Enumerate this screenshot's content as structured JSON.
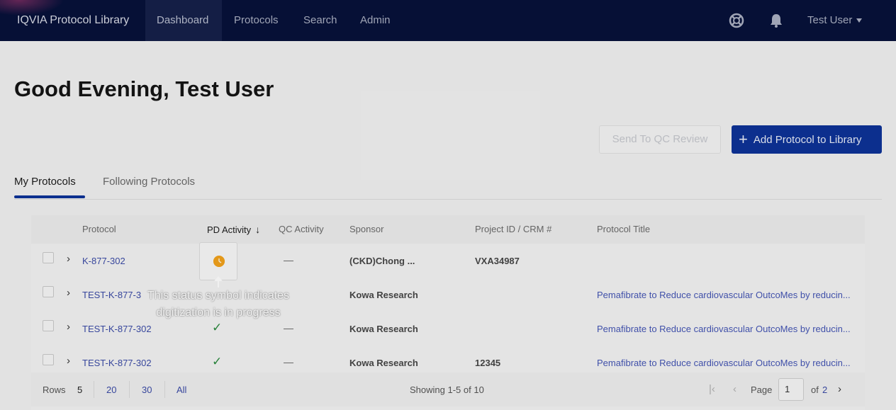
{
  "nav": {
    "brand": "IQVIA Protocol Library",
    "items": [
      {
        "label": "Dashboard"
      },
      {
        "label": "Protocols"
      },
      {
        "label": "Search"
      },
      {
        "label": "Admin"
      }
    ],
    "icons": [
      "help-icon",
      "bell-icon"
    ],
    "user": "Test User"
  },
  "greeting": "Good Evening, Test User",
  "actions": {
    "qc_review": "Send To QC Review",
    "add_protocol": "Add Protocol to Library"
  },
  "tabs": [
    {
      "label": "My Protocols"
    },
    {
      "label": "Following Protocols"
    }
  ],
  "table": {
    "headers": [
      "Protocol",
      "PD Activity",
      "QC Activity",
      "Sponsor",
      "Project ID / CRM #",
      "Protocol Title"
    ],
    "rows": [
      {
        "protocol": "K-877-302",
        "pd": "in-progress",
        "qc": "—",
        "sponsor": "(CKD)Chong ...",
        "project": "VXA34987",
        "title": ""
      },
      {
        "protocol": "TEST-K-877-3",
        "pd": "",
        "qc": "",
        "sponsor": "Kowa Research",
        "project": "",
        "title": "Pemafibrate to Reduce cardiovascular OutcoMes by reducin..."
      },
      {
        "protocol": "TEST-K-877-302",
        "pd": "✓",
        "qc": "—",
        "sponsor": "Kowa Research",
        "project": "",
        "title": "Pemafibrate to Reduce cardiovascular OutcoMes by reducin..."
      },
      {
        "protocol": "TEST-K-877-302",
        "pd": "✓",
        "qc": "—",
        "sponsor": "Kowa Research",
        "project": "12345",
        "title": "Pemafibrate to Reduce cardiovascular OutcoMes by reducin..."
      }
    ]
  },
  "tooltip": {
    "line1": "This status symbol indicates",
    "line2": "digitization is in progress"
  },
  "pagination": {
    "rows_label": "Rows",
    "sizes": [
      "5",
      "20",
      "30",
      "All"
    ],
    "showing": "Showing 1-5 of 10",
    "page_label": "Page",
    "page_value": "1",
    "of_label": "of",
    "total_pages": "2"
  },
  "colors": {
    "nav_bg": "#07123a",
    "accent": "#0d3297",
    "link": "#3b4ba6",
    "status_in_progress": "#f2a21c",
    "check": "#2b8a3e"
  }
}
